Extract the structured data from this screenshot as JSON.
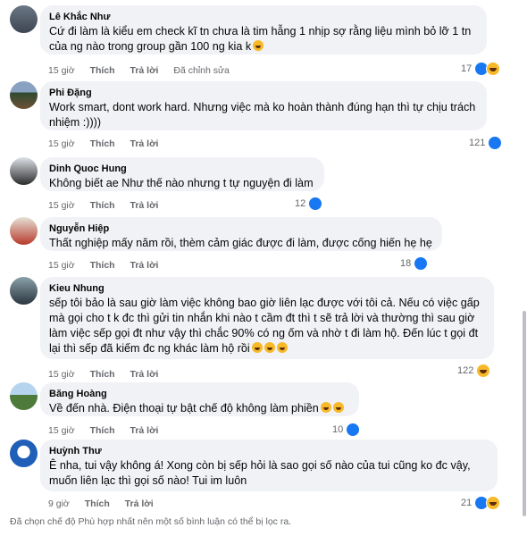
{
  "comments": [
    {
      "author": "Lê Khắc Như",
      "text": "Cứ đi làm là kiểu em check kĩ tn chưa là tim hẫng 1 nhịp sợ rằng liệu mình bỏ lỡ 1 tn của ng nào trong group gần 100 ng kia k",
      "time": "15 giờ",
      "like": "Thích",
      "reply": "Trả lời",
      "edited": "Đã chỉnh sửa",
      "reactions": "17"
    },
    {
      "author": "Phi Đặng",
      "text": "Work smart, dont work hard. Nhưng việc mà ko hoàn thành đúng hạn thì tự chịu trách nhiệm :))))",
      "time": "15 giờ",
      "like": "Thích",
      "reply": "Trả lời",
      "reactions": "121"
    },
    {
      "author": "Dinh Quoc Hung",
      "text": "Không biết ae Như thế nào nhưng t tự nguyện đi làm",
      "time": "15 giờ",
      "like": "Thích",
      "reply": "Trả lời",
      "reactions": "12"
    },
    {
      "author": "Nguyễn Hiệp",
      "text": "Thất nghiệp mấy năm rồi, thèm cảm giác được đi làm, được cống hiến hẹ hẹ",
      "time": "15 giờ",
      "like": "Thích",
      "reply": "Trả lời",
      "reactions": "18"
    },
    {
      "author": "Kieu Nhung",
      "text": "sếp tôi bảo là sau giờ làm việc không bao giờ liên lạc được với tôi cả. Nếu có việc gấp mà gọi cho t k đc thì gửi tin nhắn khi nào t cầm đt thì t sẽ trả lời và thường thì sau giờ làm việc sếp gọi đt như vậy thì chắc 90% có ng ốm và nhờ t đi làm hộ. Đến lúc t gọi đt lại thì sếp đã kiếm đc ng khác làm hộ rồi",
      "time": "15 giờ",
      "like": "Thích",
      "reply": "Trả lời",
      "reactions": "122"
    },
    {
      "author": "Băng Hoàng",
      "text": "Về đến nhà. Điện thoại tự bật chế độ không làm phiền",
      "time": "15 giờ",
      "like": "Thích",
      "reply": "Trả lời",
      "reactions": "10"
    },
    {
      "author": "Huỳnh Thư",
      "text": "Ê nha, tui vậy không á! Xong còn bị sếp hỏi là sao gọi số nào của tui cũng ko đc vậy, muốn liên lạc thì gọi số nào! Tui im luôn",
      "time": "9 giờ",
      "like": "Thích",
      "reply": "Trả lời",
      "reactions": "21"
    }
  ],
  "footer": "Đã chọn chế độ Phù hợp nhất nên một số bình luận có thể bị lọc ra.",
  "colors": {
    "bubble": "#f0f2f5",
    "meta": "#65676b",
    "like": "#1877f2",
    "haha": "#f7b928"
  }
}
